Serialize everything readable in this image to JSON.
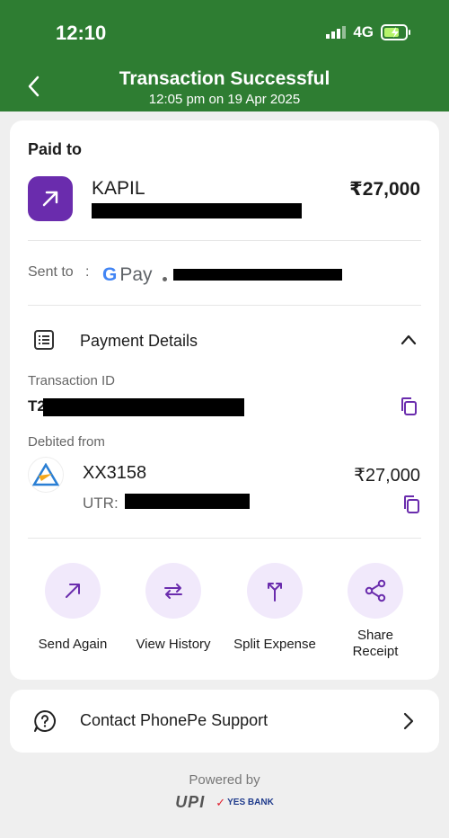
{
  "status_bar": {
    "time": "12:10",
    "network": "4G"
  },
  "header": {
    "title": "Transaction Successful",
    "subtitle": "12:05 pm on 19 Apr 2025",
    "background": "#2e7d32"
  },
  "paid": {
    "label": "Paid to",
    "name": "KAPIL",
    "amount": "₹27,000",
    "icon": "arrow-up-right-icon"
  },
  "sent_to": {
    "label": "Sent to",
    "colon": ":",
    "app": "Pay",
    "app_g": "G"
  },
  "payment_details": {
    "label": "Payment Details",
    "transaction_id_label": "Transaction ID",
    "transaction_id_prefix": "T2",
    "debited_label": "Debited from",
    "account": "XX3158",
    "amount": "₹27,000",
    "utr_label": "UTR:"
  },
  "actions": [
    {
      "label": "Send Again",
      "icon": "arrow-up-right-icon"
    },
    {
      "label": "View History",
      "icon": "swap-icon"
    },
    {
      "label": "Split Expense",
      "icon": "split-icon"
    },
    {
      "label": "Share Receipt",
      "icon": "share-icon"
    }
  ],
  "support": {
    "label": "Contact PhonePe Support"
  },
  "footer": {
    "powered": "Powered by",
    "upi": "UPI",
    "bank": "YES BANK"
  },
  "colors": {
    "accent": "#6a2cad",
    "action_bg": "#f1e9fb",
    "page_bg": "#efefef"
  }
}
